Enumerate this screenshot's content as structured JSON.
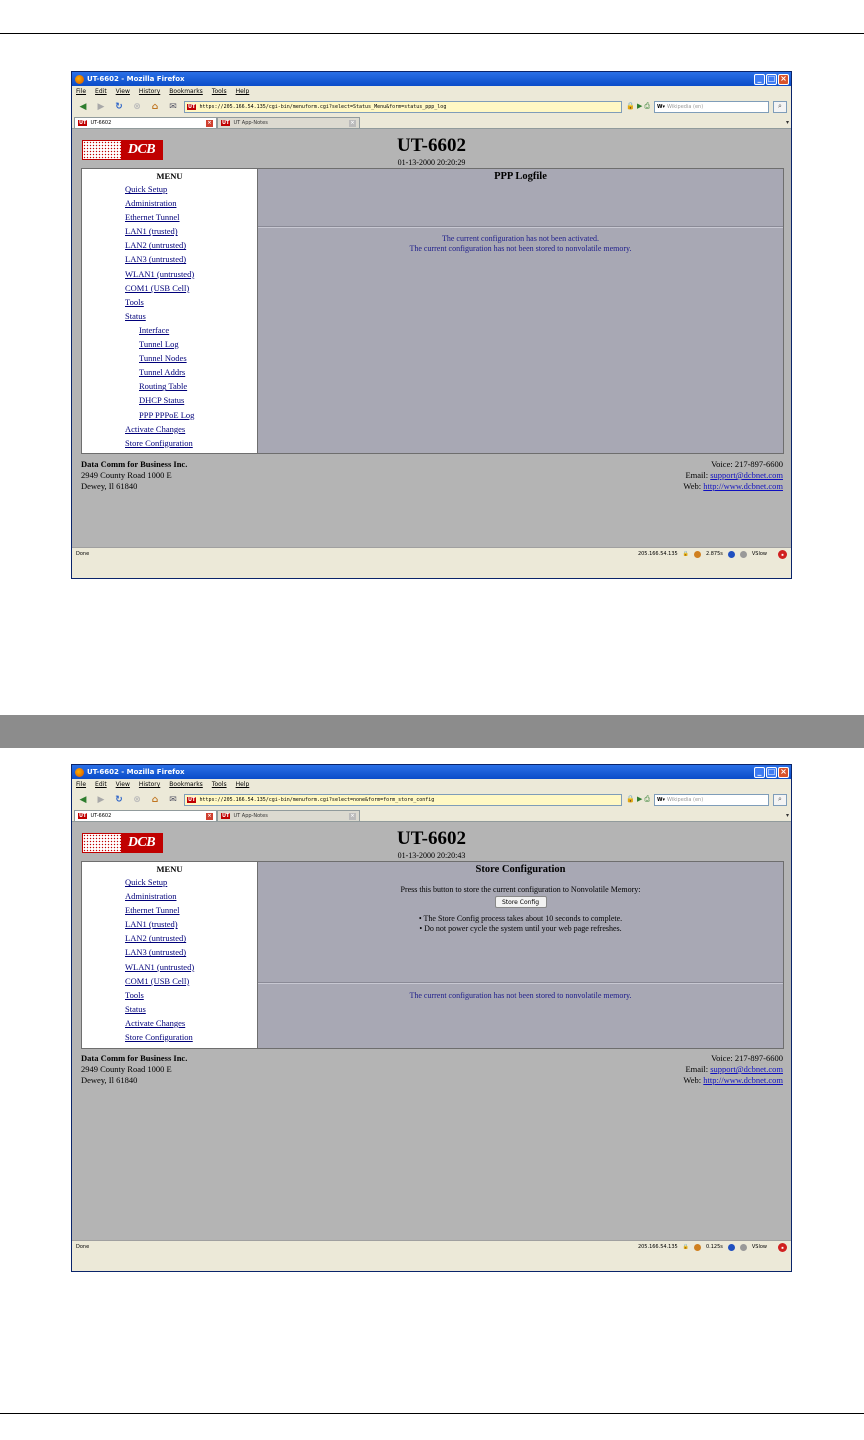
{
  "browser": {
    "window_title": "UT-6602 - Mozilla Firefox",
    "menu": [
      "File",
      "Edit",
      "View",
      "History",
      "Bookmarks",
      "Tools",
      "Help"
    ],
    "tabs": [
      "UT-6602",
      "UT App-Notes"
    ],
    "search_placeholder": "Wikipedia (en)",
    "status_done": "Done",
    "status_ip": "205.166.54.135",
    "status_view": "VSlow"
  },
  "page": {
    "title": "UT-6602",
    "menu_header": "MENU",
    "footer": {
      "company": "Data Comm for Business Inc.",
      "address": "2949 County Road 1000 E",
      "city": "Dewey, Il 61840",
      "voice": "Voice: 217-897-6600",
      "email_label": "Email:",
      "email": "support@dcbnet.com",
      "web_label": "Web:",
      "web": "http://www.dcbnet.com"
    }
  },
  "screen1": {
    "url": "https://205.166.54.135/cgi-bin/menuform.cgi?select=Status_Menu&form=status_ppp_log",
    "timestamp": "01-13-2000 20:20:29",
    "heading": "PPP Logfile",
    "menu_items": [
      "Quick Setup",
      "Administration",
      "Ethernet Tunnel",
      "LAN1 (trusted)",
      "LAN2 (untrusted)",
      "LAN3 (untrusted)",
      "WLAN1 (untrusted)",
      "COM1 (USB Cell)",
      "Tools",
      "Status"
    ],
    "status_submenu": [
      "Interface",
      "Tunnel Log",
      "Tunnel Nodes",
      "Tunnel Addrs",
      "Routing Table",
      "DHCP Status",
      "PPP PPPoE Log"
    ],
    "menu_items_after": [
      "Activate Changes",
      "Store Configuration"
    ],
    "message_line1": "The current configuration has not been activated.",
    "message_line2": "The current configuration has not been stored to nonvolatile memory.",
    "status_timing": "2.875s"
  },
  "screen2": {
    "url": "https://205.166.54.135/cgi-bin/menuform.cgi?select=none&form=form_store_config",
    "timestamp": "01-13-2000 20:20:43",
    "heading": "Store Configuration",
    "menu_items": [
      "Quick Setup",
      "Administration",
      "Ethernet Tunnel",
      "LAN1 (trusted)",
      "LAN2 (untrusted)",
      "LAN3 (untrusted)",
      "WLAN1 (untrusted)",
      "COM1 (USB Cell)",
      "Tools",
      "Status",
      "Activate Changes",
      "Store Configuration"
    ],
    "prompt": "Press this button to store the current configuration to Nonvolatile Memory:",
    "button_label": "Store Config",
    "note1": "• The Store Config process takes about 10 seconds to complete.",
    "note2": "• Do not power cycle the system until your web page refreshes.",
    "message": "The current configuration has not been stored to nonvolatile memory.",
    "status_timing": "0.125s"
  }
}
